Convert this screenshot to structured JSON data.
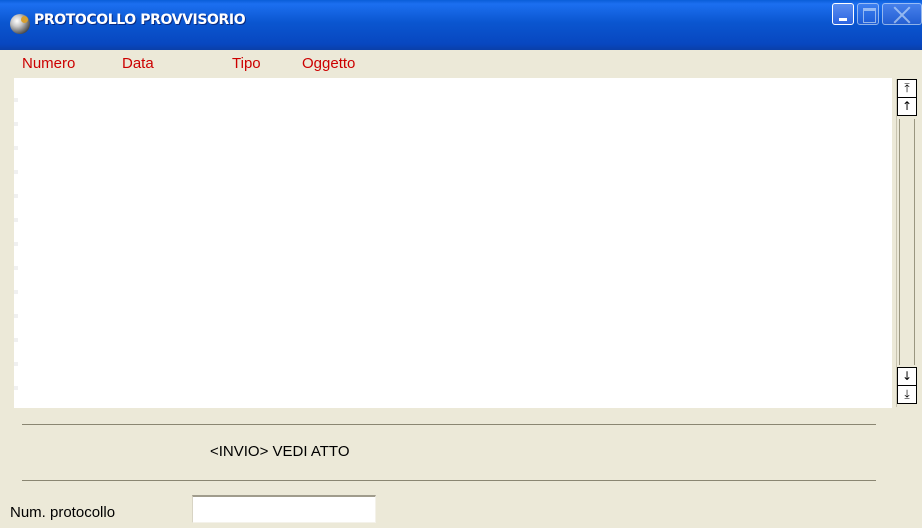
{
  "window": {
    "title": "PROTOCOLLO PROVVISORIO"
  },
  "list": {
    "columns": [
      {
        "label": "Numero"
      },
      {
        "label": "Data"
      },
      {
        "label": "Tipo"
      },
      {
        "label": "Oggetto"
      }
    ],
    "rows": []
  },
  "scrollbar": {
    "top_glyph": "⤒",
    "up_glyph": "↑",
    "down_glyph": "↓",
    "bottom_glyph": "⤓"
  },
  "hint": "<INVIO> VEDI ATTO",
  "form": {
    "num_protocollo_label": "Num. protocollo",
    "num_protocollo_value": ""
  },
  "colors": {
    "header_text": "#cc0000",
    "titlebar": "#0a56d0",
    "window_bg": "#ece9d8"
  },
  "icons": [
    "app-icon",
    "minimize-icon",
    "maximize-icon",
    "close-icon",
    "scroll-top-icon",
    "scroll-up-icon",
    "scroll-down-icon",
    "scroll-bottom-icon"
  ]
}
